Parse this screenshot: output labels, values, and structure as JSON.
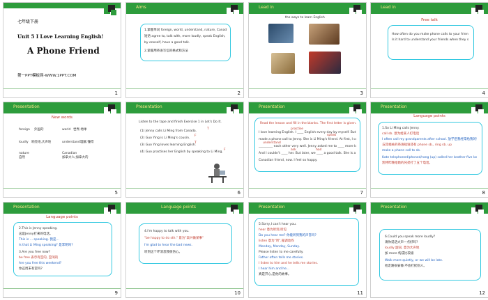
{
  "slides": [
    {
      "num": "1",
      "grade": "七年级下册",
      "unit": "Unit 5  I Love Learning English!",
      "title": "A Phone Friend",
      "site": "第一PPT模板网-WWW.1PPT.COM"
    },
    {
      "num": "2",
      "header": "Aims",
      "lines": [
        "1.掌握单词 foreign, world, understand, nature, Canadian",
        "短语 agree to, talk with, more loudly, speak English, learn English,",
        "by oneself, have a good talk.",
        "2.掌握用英语写信的格式和方法"
      ]
    },
    {
      "num": "3",
      "header": "Lead in",
      "caption": "the ways to learn English"
    },
    {
      "num": "4",
      "header": "Lead in",
      "subtitle": "Free talk",
      "lines": [
        "How often do you make phone calls to your friends?",
        "Is it hard to understand your friends when they speak English?"
      ]
    },
    {
      "num": "5",
      "header": "Presentation",
      "subtitle": "New words",
      "words": [
        [
          "foreign",
          "外国的"
        ],
        [
          "world",
          "世界,地球"
        ],
        [
          "loudly",
          "响亮地,大声地"
        ],
        [
          "understand",
          "理解,懂得"
        ],
        [
          "nature",
          "自然"
        ],
        [
          "Canadian",
          "加拿大人;加拿大的"
        ]
      ]
    },
    {
      "num": "6",
      "header": "Presentation",
      "intro": "Listen to the tape and finish Exercise 1 in Let's Do It.",
      "items": [
        "(1) Jenny calls Li Ming from Canada.",
        "(2) Guo Ying is Li Ming's cousin.",
        "(3) Guo Ying loves learning English.",
        "(4) Guo practises her English by speaking to Li Ming."
      ],
      "marks": [
        "T",
        "F",
        "T",
        "F"
      ]
    },
    {
      "num": "7",
      "header": "Presentation",
      "intro": "Read the lesson and fill in the blanks. The first letter is given.",
      "lines": [
        "I love learning English. I ____ English every day by myself. But today, I",
        "made a phone call to Jenny. She is Li Ming's friend. At first, I couldn't",
        "_________ each other very well. Jenny asked me to ____ more loudly.",
        "And I couldn't ____ her. But later, we ____ a good talk. She is a",
        "Canadian friend, now. I feel so happy."
      ],
      "answers": [
        "practise",
        "speak",
        "understand",
        "ask",
        "had"
      ]
    },
    {
      "num": "8",
      "header": "Presentation",
      "subtitle": "Language points",
      "lines": [
        "1.So Li Ming calls Jenny.",
        "call sb. 意为给某人打电话",
        "I often call my grandparents after school. 放学后我经常给我的祖父母打电话。",
        "与其相关的英语短语还有 phone sb., ring sb. up",
        "make a phone call to sb.",
        "Kate telephoned/phoned/rang (up) called her brother five last night.",
        "凯特昨晚给她的兄弟打了五个电话。"
      ]
    },
    {
      "num": "9",
      "header": "Presentation",
      "subtitle": "Language points",
      "lines": [
        "2.This is Jenny speaking.",
        "这是Jenny打来的电话。",
        "This is ... speaking. 我是...",
        "Is that Li Ming speaking? 是李明吗?",
        "3.Are you free now?",
        "be free 表示有空的, 空闲的",
        "Are you free this weekend?",
        "你这周末有空吗?"
      ]
    },
    {
      "num": "10",
      "header": "Language points",
      "lines": [
        "4.I'm happy to talk with you.",
        "\"be happy to do sth.\" 意为\"高兴做某事\"",
        "I'm glad to hear the bad news.",
        "听到这个坏消息我很伤心。"
      ]
    },
    {
      "num": "11",
      "header": "Presentation",
      "lines": [
        "5.Sorry,I can't hear you.",
        "hear 意为听到,听见",
        "Do you hear me? 你能听到我的声音吗?",
        "listen 意为\"听\",强调动作",
        "Monday, Monday, Sunday.",
        "Please listen to me carefully.",
        "Father often tells me stories.",
        "I listen to him and he tells me stories.",
        "I hear him and he...",
        "真是开心,是他的故事。"
      ]
    },
    {
      "num": "12",
      "header": "Presentation",
      "lines": [
        "6.Could you speak more loudly?",
        "请你说话大声一点好吗?",
        "loudly 副词, 意为大声地",
        "加 more 构成比较级",
        "Walk more quietly, or we will be late.",
        "他走路很安静,不会打扰别人。"
      ]
    }
  ],
  "colors": {
    "bar": "#2d9c3c",
    "header_text": "#fde68a",
    "box_border": "#31c8e0",
    "red": "#c0392b"
  }
}
